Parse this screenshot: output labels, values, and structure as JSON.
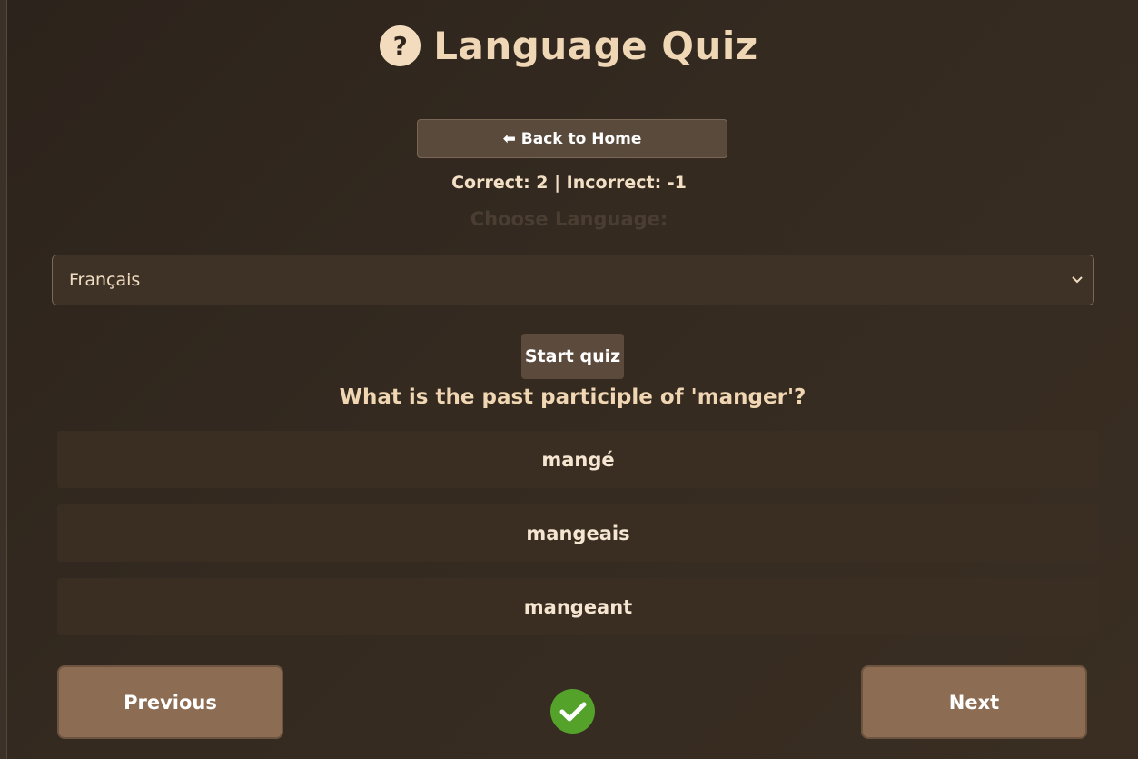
{
  "header": {
    "icon": "question-circle-icon",
    "icon_glyph": "?",
    "title": "Language Quiz"
  },
  "nav": {
    "back_label": "⬅ Back to Home"
  },
  "score": {
    "text": "Correct: 2 | Incorrect: -1"
  },
  "language": {
    "label": "Choose Language:",
    "selected": "Français"
  },
  "quiz": {
    "start_label": "Start quiz",
    "question": "What is the past participle of 'manger'?",
    "answers": [
      {
        "label": "mangé"
      },
      {
        "label": "mangeais"
      },
      {
        "label": "mangeant"
      }
    ]
  },
  "footer": {
    "previous_label": "Previous",
    "next_label": "Next",
    "status_icon": "check-circle-icon",
    "status_color": "#55a22b"
  }
}
